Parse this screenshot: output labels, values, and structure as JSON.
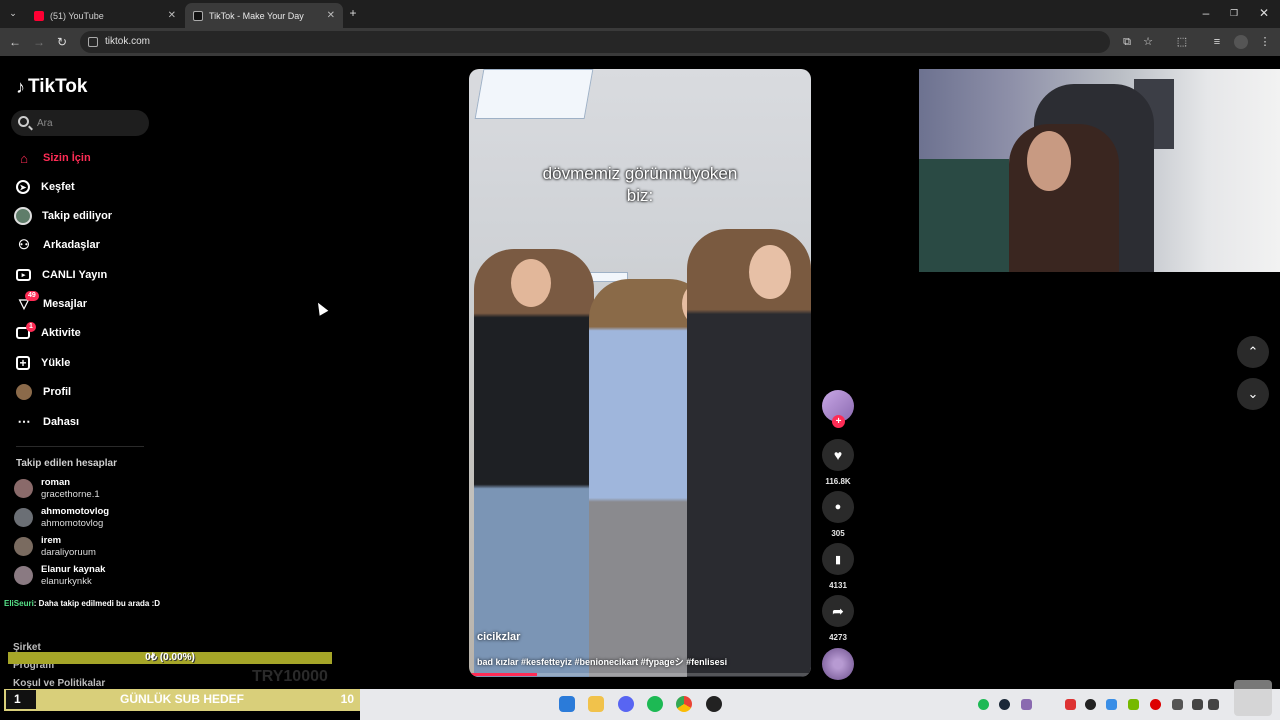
{
  "browser": {
    "tabs": [
      {
        "label": "(51) YouTube",
        "icon": "youtube-icon",
        "active": false
      },
      {
        "label": "TikTok - Make Your Day",
        "icon": "tiktok-icon",
        "active": true
      }
    ],
    "new_tab": "+",
    "url": "tiktok.com"
  },
  "tiktok": {
    "logo": "TikTok",
    "search_placeholder": "Ara",
    "nav": [
      {
        "label": "Sizin İçin",
        "icon": "home-icon"
      },
      {
        "label": "Keşfet",
        "icon": "compass-icon"
      },
      {
        "label": "Takip ediliyor",
        "icon": "following-avatar-icon"
      },
      {
        "label": "Arkadaşlar",
        "icon": "friends-icon"
      },
      {
        "label": "CANLI Yayın",
        "icon": "live-icon"
      },
      {
        "label": "Mesajlar",
        "icon": "message-icon",
        "badge": "49"
      },
      {
        "label": "Aktivite",
        "icon": "activity-icon",
        "badge": "1"
      },
      {
        "label": "Yükle",
        "icon": "upload-icon"
      },
      {
        "label": "Profil",
        "icon": "profile-avatar-icon"
      },
      {
        "label": "Dahası",
        "icon": "more-icon"
      }
    ],
    "following_title": "Takip edilen hesaplar",
    "following": [
      {
        "name": "roman",
        "handle": "gracethorne.1"
      },
      {
        "name": "ahmomotovlog",
        "handle": "ahmomotovlog"
      },
      {
        "name": "irem",
        "handle": "daraliyoruum"
      },
      {
        "name": "Elanur kaynak",
        "handle": "elanurkynkk"
      }
    ],
    "footer": [
      "Şirket",
      "Program",
      "Koşul ve Politikalar"
    ]
  },
  "video": {
    "caption_line1": "dövmemiz görünmüyoken",
    "caption_line2": "biz:",
    "author": "cicikzlar",
    "description": "bad kızlar #kesfetteyiz #benionecikart #fypageシ #fenlisesi",
    "progress": 0.2,
    "actions": {
      "likes": "116.8K",
      "comments": "305",
      "saves": "4131",
      "shares": "4273"
    }
  },
  "stream_overlay": {
    "chat_user": "EliSeuri",
    "chat_message": ": Daha takip edilmedi bu arada :D",
    "goal_text": "0₺ (0.00%)",
    "goal_amount": "TRY10000",
    "sub_goal_count": "1",
    "sub_goal_title": "GÜNLÜK SUB HEDEF",
    "sub_goal_target": "10"
  },
  "colors": {
    "accent": "#fe2c55",
    "background": "#000000",
    "goal_bar": "#a5a528",
    "sub_goal_bg": "#d9cf7a"
  }
}
